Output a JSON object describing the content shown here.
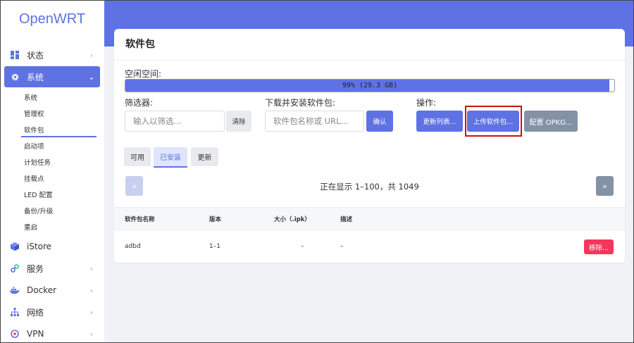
{
  "app": {
    "logo": "OpenWRT"
  },
  "sidebar": {
    "items": [
      {
        "label": "状态",
        "icon": "dashboard-icon"
      },
      {
        "label": "系统",
        "icon": "gear-icon",
        "active": true
      },
      {
        "label": "iStore",
        "icon": "cube-icon"
      },
      {
        "label": "服务",
        "icon": "link-icon"
      },
      {
        "label": "Docker",
        "icon": "docker-icon"
      },
      {
        "label": "网络",
        "icon": "network-icon"
      },
      {
        "label": "VPN",
        "icon": "vpn-icon"
      }
    ],
    "sub_items": [
      "系统",
      "管理权",
      "软件包",
      "启动项",
      "计划任务",
      "挂载点",
      "LED 配置",
      "备份/升级",
      "重启"
    ],
    "active_sub": "软件包"
  },
  "page": {
    "title": "软件包",
    "free_space_label": "空闲空间:",
    "progress": {
      "text": "99% (29.3 GB)",
      "fraction": 0.99
    },
    "filter": {
      "label": "筛选器:",
      "placeholder": "输入以筛选...",
      "clear_label": "清除"
    },
    "download": {
      "label": "下载并安装软件包:",
      "placeholder": "软件包名称或 URL...",
      "confirm_label": "确认"
    },
    "actions": {
      "label": "操作:",
      "update_label": "更新列表...",
      "upload_label": "上传软件包...",
      "configure_label": "配置 OPKG..."
    },
    "tabs": [
      {
        "label": "可用"
      },
      {
        "label": "已安装",
        "active": true
      },
      {
        "label": "更新"
      }
    ],
    "pager": {
      "prev": "«",
      "next": "»",
      "status": "正在显示 1–100，共 1049"
    },
    "table": {
      "headers": [
        "软件包名称",
        "版本",
        "大小（.ipk）",
        "描述"
      ],
      "rows": [
        {
          "name": "adbd",
          "version": "1–1",
          "size": "–",
          "description": "–",
          "remove_label": "移除..."
        }
      ]
    }
  },
  "colors": {
    "accent": "#5e72e4",
    "danger": "#f5365c",
    "slate": "#8492a6",
    "highlight": "#d01010"
  }
}
